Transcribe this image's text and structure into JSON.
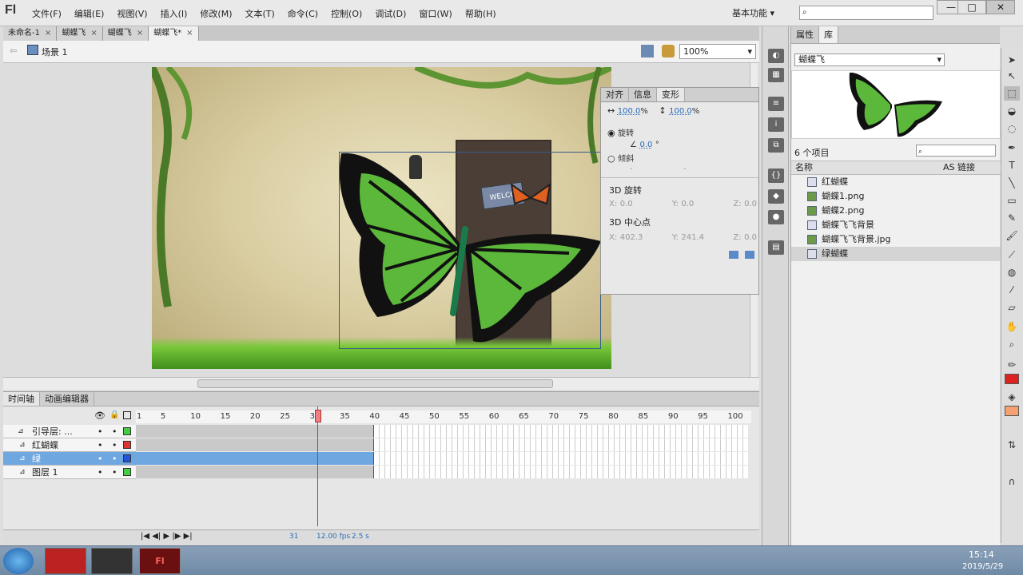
{
  "app": {
    "logo": "Fl"
  },
  "menu": [
    "文件(F)",
    "编辑(E)",
    "视图(V)",
    "插入(I)",
    "修改(M)",
    "文本(T)",
    "命令(C)",
    "控制(O)",
    "调试(D)",
    "窗口(W)",
    "帮助(H)"
  ],
  "workspace": "基本功能",
  "window_buttons": [
    "—",
    "□",
    "✕"
  ],
  "doc_tabs": [
    {
      "label": "未命名-1",
      "active": false
    },
    {
      "label": "蝴蝶飞",
      "active": false
    },
    {
      "label": "蝴蝶飞",
      "active": false
    },
    {
      "label": "蝴蝶飞*",
      "active": true
    }
  ],
  "scene": {
    "label": "场景 1",
    "zoom": "100%"
  },
  "stage": {
    "sign_text": "WELCO"
  },
  "properties_panel": {
    "tabs": [
      "对齐",
      "信息",
      "变形"
    ],
    "width_pct": "100.0",
    "height_pct": "100.0",
    "percent": "%",
    "rotate_label": "旋转",
    "rotate_value": "0.0",
    "degree": "°",
    "skew_label": "倾斜",
    "skew_h": "-",
    "skew_v": "-",
    "rot3d_label": "3D 旋转",
    "rot3d": {
      "x": "0.0",
      "y": "0.0",
      "z": "0.0"
    },
    "center3d_label": "3D 中心点",
    "center3d": {
      "x": "402.3",
      "y": "241.4",
      "z": "0.0"
    },
    "axis": {
      "x": "X:",
      "y": "Y:",
      "z": "Z:"
    }
  },
  "library": {
    "tabs": [
      "属性",
      "库"
    ],
    "doc": "蝴蝶飞",
    "count": "6 个项目",
    "col_name": "名称",
    "col_link": "AS 链接",
    "items": [
      {
        "label": "红蝴蝶",
        "type": "symbol",
        "selected": false
      },
      {
        "label": "蝴蝶1.png",
        "type": "png",
        "selected": false
      },
      {
        "label": "蝴蝶2.png",
        "type": "png",
        "selected": false
      },
      {
        "label": "蝴蝶飞飞背景",
        "type": "symbol",
        "selected": false
      },
      {
        "label": "蝴蝶飞飞背景.jpg",
        "type": "png",
        "selected": false
      },
      {
        "label": "绿蝴蝶",
        "type": "symbol",
        "selected": true
      }
    ]
  },
  "timeline": {
    "tabs": [
      "时间轴",
      "动画编辑器"
    ],
    "ruler": [
      "1",
      "5",
      "10",
      "15",
      "20",
      "25",
      "30",
      "35",
      "40",
      "45",
      "50",
      "55",
      "60",
      "65",
      "70",
      "75",
      "80",
      "85",
      "90",
      "95",
      "100"
    ],
    "layers": [
      {
        "name": "引导层: ...",
        "color": "#44cc44",
        "selected": false
      },
      {
        "name": "红蝴蝶",
        "color": "#dd3333",
        "selected": false
      },
      {
        "name": "绿",
        "color": "#2255dd",
        "selected": true
      },
      {
        "name": "图层 1",
        "color": "#44cc44",
        "selected": false
      }
    ],
    "current_frame": "31",
    "fps": "12.00 fps",
    "time": "2.5 s",
    "current_frame_value": 31
  },
  "taskbar": {
    "time": "15:14",
    "date": "2019/5/29"
  },
  "colors": {
    "stroke": "#dd2222",
    "fill": "#f4a070",
    "accent": "#6fa8e0"
  }
}
